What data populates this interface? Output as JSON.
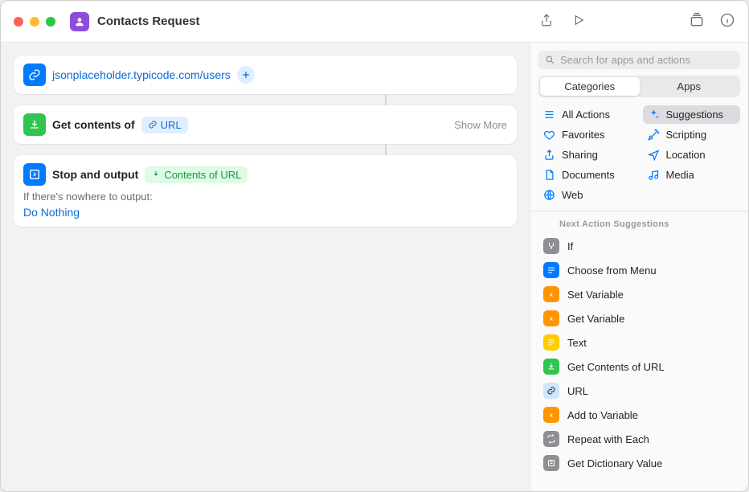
{
  "window": {
    "title": "Contacts Request"
  },
  "actions": {
    "url": {
      "value": "jsonplaceholder.typicode.com/users"
    },
    "get_contents": {
      "label": "Get contents of",
      "token": "URL",
      "show_more": "Show More"
    },
    "output": {
      "label": "Stop and output",
      "token": "Contents of URL",
      "fallback_label": "If there's nowhere to output:",
      "fallback_value": "Do Nothing"
    }
  },
  "search": {
    "placeholder": "Search for apps and actions"
  },
  "segmented": {
    "categories": "Categories",
    "apps": "Apps"
  },
  "categories": {
    "left": [
      {
        "label": "All Actions",
        "icon": "list"
      },
      {
        "label": "Favorites",
        "icon": "heart"
      },
      {
        "label": "Sharing",
        "icon": "share"
      },
      {
        "label": "Documents",
        "icon": "doc"
      },
      {
        "label": "Web",
        "icon": "globe"
      }
    ],
    "right": [
      {
        "label": "Suggestions",
        "icon": "sparkle",
        "selected": true
      },
      {
        "label": "Scripting",
        "icon": "wand"
      },
      {
        "label": "Location",
        "icon": "arrow"
      },
      {
        "label": "Media",
        "icon": "music"
      }
    ]
  },
  "suggestions_heading": "Next Action Suggestions",
  "suggestions": [
    {
      "label": "If",
      "color": "sg-grey",
      "glyph": "branch"
    },
    {
      "label": "Choose from Menu",
      "color": "sg-blue",
      "glyph": "menu"
    },
    {
      "label": "Set Variable",
      "color": "sg-orange",
      "glyph": "x"
    },
    {
      "label": "Get Variable",
      "color": "sg-orange",
      "glyph": "x"
    },
    {
      "label": "Text",
      "color": "sg-yellow",
      "glyph": "text"
    },
    {
      "label": "Get Contents of URL",
      "color": "sg-green",
      "glyph": "download"
    },
    {
      "label": "URL",
      "color": "sg-lightblue",
      "glyph": "link"
    },
    {
      "label": "Add to Variable",
      "color": "sg-orange",
      "glyph": "x"
    },
    {
      "label": "Repeat with Each",
      "color": "sg-grey",
      "glyph": "repeat"
    },
    {
      "label": "Get Dictionary Value",
      "color": "sg-grey",
      "glyph": "dict"
    }
  ]
}
